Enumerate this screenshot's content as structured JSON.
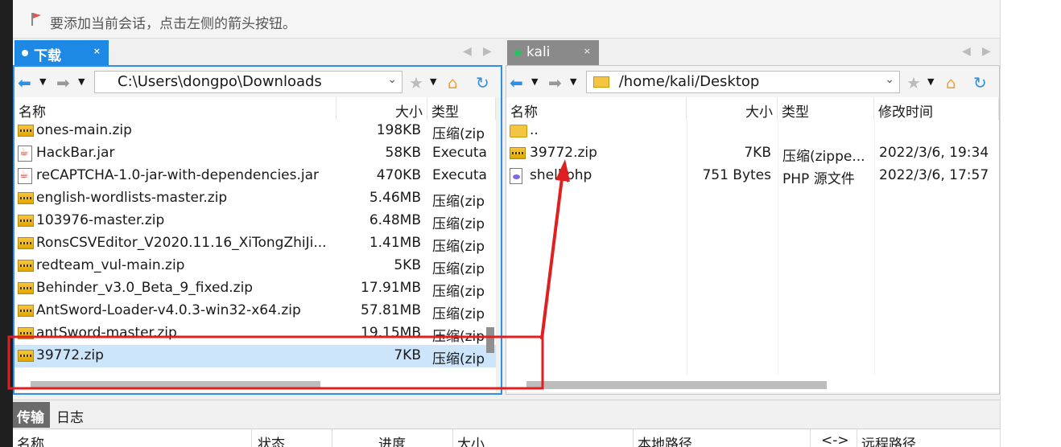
{
  "hint": {
    "text": "要添加当前会话，点击左侧的箭头按钮。"
  },
  "left_panel": {
    "tab_label": "下载",
    "tab_close": "×",
    "path": "C:\\Users\\dongpo\\Downloads",
    "columns": {
      "name": "名称",
      "size": "大小",
      "type": "类型"
    },
    "rows": [
      {
        "icon": "zip-icon",
        "name": "ones-main.zip",
        "size": "198KB",
        "type": "压缩(zip"
      },
      {
        "icon": "jar-icon",
        "name": "HackBar.jar",
        "size": "58KB",
        "type": "Executa"
      },
      {
        "icon": "jar-icon",
        "name": "reCAPTCHA-1.0-jar-with-dependencies.jar",
        "size": "470KB",
        "type": "Executa"
      },
      {
        "icon": "zip-icon",
        "name": "english-wordlists-master.zip",
        "size": "5.46MB",
        "type": "压缩(zip"
      },
      {
        "icon": "zip-icon",
        "name": "103976-master.zip",
        "size": "6.48MB",
        "type": "压缩(zip"
      },
      {
        "icon": "zip-icon",
        "name": "RonsCSVEditor_V2020.11.16_XiTongZhiJi...",
        "size": "1.41MB",
        "type": "压缩(zip"
      },
      {
        "icon": "zip-icon",
        "name": "redteam_vul-main.zip",
        "size": "5KB",
        "type": "压缩(zip"
      },
      {
        "icon": "zip-icon",
        "name": "Behinder_v3.0_Beta_9_fixed.zip",
        "size": "17.91MB",
        "type": "压缩(zip"
      },
      {
        "icon": "zip-icon",
        "name": "AntSword-Loader-v4.0.3-win32-x64.zip",
        "size": "57.81MB",
        "type": "压缩(zip"
      },
      {
        "icon": "zip-icon",
        "name": "antSword-master.zip",
        "size": "19.15MB",
        "type": "压缩(zip"
      },
      {
        "icon": "zip-icon",
        "name": "39772.zip",
        "size": "7KB",
        "type": "压缩(zip",
        "selected": true
      }
    ]
  },
  "right_panel": {
    "tab_label": "kali",
    "tab_close": "×",
    "path": "/home/kali/Desktop",
    "columns": {
      "name": "名称",
      "size": "大小",
      "type": "类型",
      "modified": "修改时间"
    },
    "rows": [
      {
        "icon": "folder-icon",
        "name": "..",
        "size": "",
        "type": "",
        "modified": ""
      },
      {
        "icon": "zip-icon",
        "name": "39772.zip",
        "size": "7KB",
        "type": "压缩(zippe...",
        "modified": "2022/3/6, 19:34"
      },
      {
        "icon": "php-icon",
        "name": "shell.php",
        "size": "751 Bytes",
        "type": "PHP 源文件",
        "modified": "2022/3/6, 17:57"
      }
    ]
  },
  "bottom": {
    "tab_transfer": "传输",
    "tab_log": "日志",
    "columns": {
      "name": "名称",
      "status": "状态",
      "progress": "进度",
      "size": "大小",
      "local": "本地路径",
      "dir": "<->",
      "remote": "远程路径"
    }
  },
  "colors": {
    "accent": "#1e88e5",
    "annotation": "#e02020",
    "selection": "#cce5fb"
  }
}
